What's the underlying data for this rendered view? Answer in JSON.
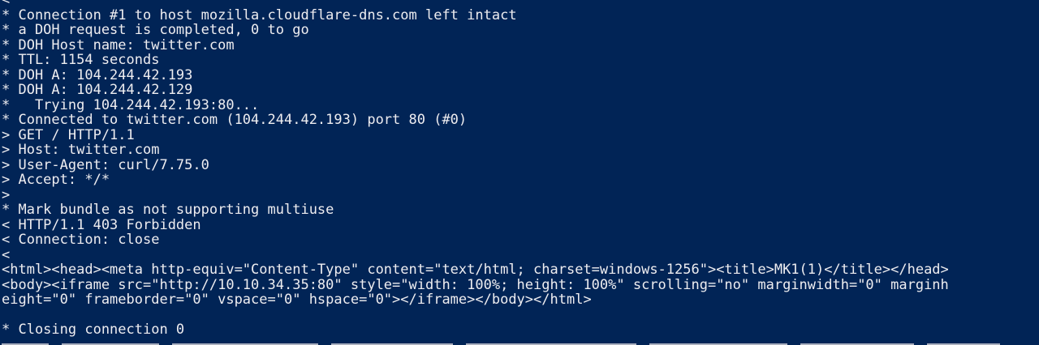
{
  "terminal": {
    "background": "#012456",
    "foreground": "#eeedf0",
    "lines": [
      "<",
      "* Connection #1 to host mozilla.cloudflare-dns.com left intact",
      "* a DOH request is completed, 0 to go",
      "* DOH Host name: twitter.com",
      "* TTL: 1154 seconds",
      "* DOH A: 104.244.42.193",
      "* DOH A: 104.244.42.129",
      "*   Trying 104.244.42.193:80...",
      "* Connected to twitter.com (104.244.42.193) port 80 (#0)",
      "> GET / HTTP/1.1",
      "> Host: twitter.com",
      "> User-Agent: curl/7.75.0",
      "> Accept: */*",
      ">",
      "* Mark bundle as not supporting multiuse",
      "< HTTP/1.1 403 Forbidden",
      "< Connection: close",
      "<",
      "<html><head><meta http-equiv=\"Content-Type\" content=\"text/html; charset=windows-1256\"><title>MK1(1)</title></head>",
      "<body><iframe src=\"http://10.10.34.35:80\" style=\"width: 100%; height: 100%\" scrolling=\"no\" marginwidth=\"0\" marginh",
      "eight=\"0\" frameborder=\"0\" vspace=\"0\" hspace=\"0\"></iframe></body></html>",
      "",
      "* Closing connection 0"
    ]
  }
}
